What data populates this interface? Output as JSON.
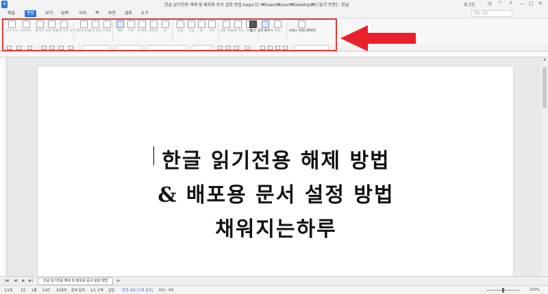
{
  "window": {
    "title": "한글 읽기전용 해제 및 배포용 문서 설정 방법.hwpx [C:₩Users₩user₩Desktop₩] [읽기 전용] - 한글",
    "login": "로그인",
    "icons": [
      "app-logo-icon",
      "minimize-icon",
      "help-icon",
      "close-icon"
    ]
  },
  "menu": {
    "items": [
      {
        "label": "파일"
      },
      {
        "label": "편집"
      },
      {
        "label": "보기"
      },
      {
        "label": "입력"
      },
      {
        "label": "서식"
      },
      {
        "label": "쪽"
      },
      {
        "label": "보안"
      },
      {
        "label": "검토"
      },
      {
        "label": "도구"
      }
    ],
    "active": "편집",
    "search_placeholder": "찾을 내용"
  },
  "ribbon": {
    "buttons": [
      {
        "label": "오려 두기"
      },
      {
        "label": "복사하기"
      },
      {
        "label": "붙이기"
      },
      {
        "label": "모양 복사"
      },
      {
        "label": "조판 부호 지우기"
      },
      {
        "label": "글자 모양"
      },
      {
        "label": "문단 모양"
      },
      {
        "label": "스타일"
      },
      {
        "label": "세로"
      },
      {
        "label": "가로"
      },
      {
        "label": "쪽 여백"
      },
      {
        "label": "바탕쪽"
      },
      {
        "label": "단"
      },
      {
        "label": "도형"
      },
      {
        "label": "그림"
      },
      {
        "label": "표"
      },
      {
        "label": "차트"
      },
      {
        "label": "개체 선택"
      },
      {
        "label": "개체 속성"
      },
      {
        "label": "정렬"
      },
      {
        "label": "찾기"
      },
      {
        "label": "글자 바꾸기"
      },
      {
        "label": "조판"
      },
      {
        "label": "오피스 커뮤니케이터"
      }
    ]
  },
  "document": {
    "lines": [
      "한글 읽기전용 해제 방법",
      "& 배포용 문서 설정 방법",
      "채워지는하루"
    ]
  },
  "tabs": {
    "doc_tab": "한글 읽기전용 해제 및 배포용 문서 설정 방법",
    "add": "+"
  },
  "status": {
    "page": "1/1쪽",
    "section": "1단",
    "line": "1줄",
    "col": "13칸",
    "chars": "33글자",
    "mode": "문자 입력",
    "area": "1/1 구역",
    "insert": "삽입",
    "track": "변경 내용 [기록 중지]",
    "extra": "타수 : 0타",
    "zoom": "210%"
  },
  "colors": {
    "accent": "#2b78d7",
    "highlight": "#e53935",
    "arrow": "#e8202a"
  }
}
